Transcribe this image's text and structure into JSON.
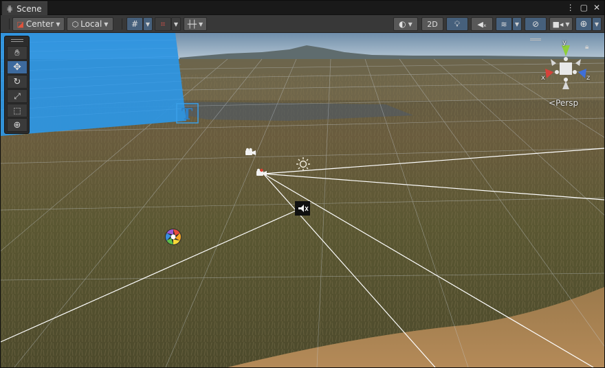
{
  "window": {
    "tab_title": "Scene",
    "tab_icon": "hash-grid-icon",
    "controls": [
      "kebab-menu-icon",
      "maximize-icon",
      "close-icon"
    ]
  },
  "toolbar": {
    "pivot_mode": "Center",
    "pivot_rotation": "Local",
    "view_2d": "2D"
  },
  "tools": [
    "hand-tool",
    "move-tool",
    "rotate-tool",
    "scale-tool",
    "rect-tool",
    "transform-tool"
  ],
  "active_tool": "move-tool",
  "gizmo": {
    "y_label": "y",
    "x_label": "x",
    "z_label": "z",
    "projection_label": "Persp",
    "colors": {
      "x": "#d6413a",
      "y": "#8fce3a",
      "z": "#3f6fd8"
    }
  },
  "colors": {
    "accent": "#46607c",
    "canvas_blue": "#2e95e0"
  },
  "scene_icons": [
    "text-gizmo-icon",
    "camera-icon",
    "camera-icon-selected",
    "light-sun-icon",
    "audio-source-icon",
    "reflection-probe-icon"
  ]
}
